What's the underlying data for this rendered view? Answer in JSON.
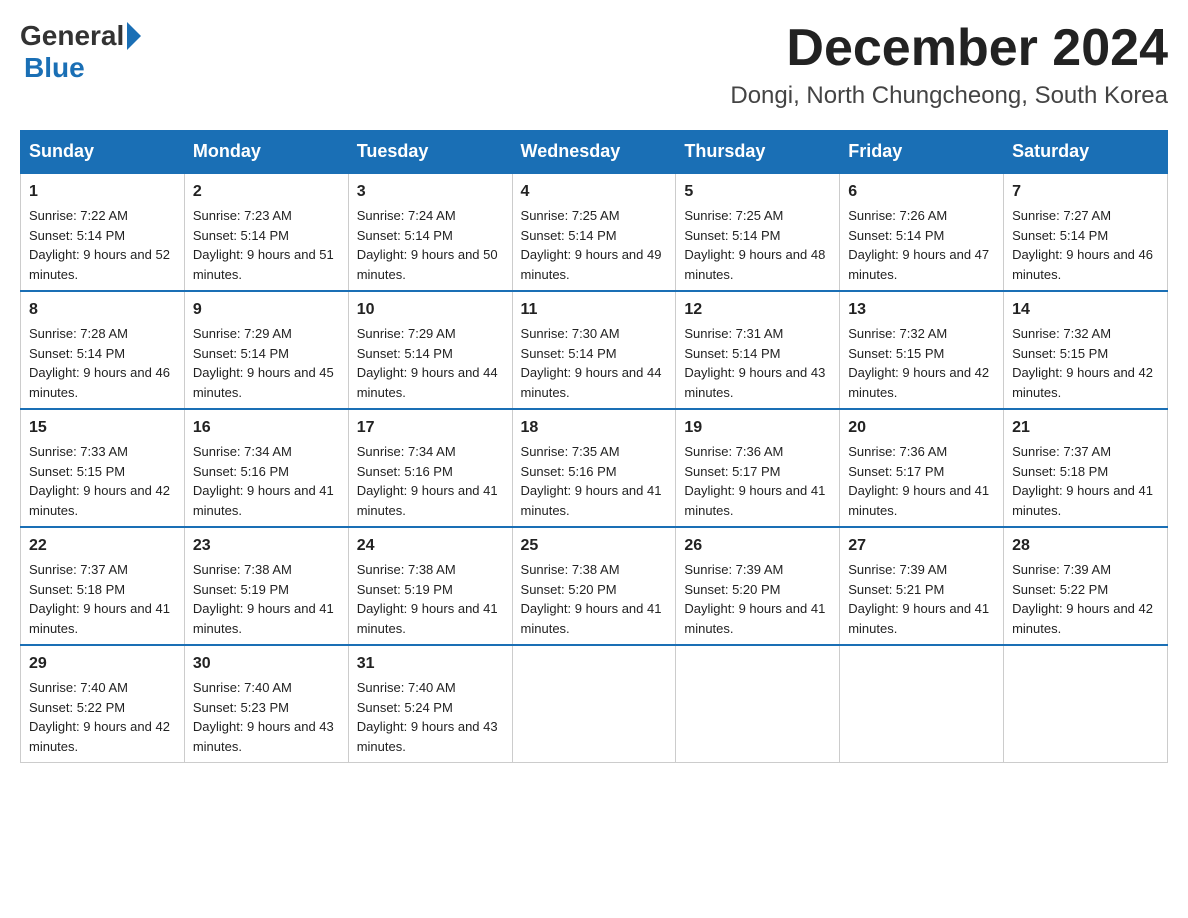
{
  "logo": {
    "general": "General",
    "blue": "Blue"
  },
  "header": {
    "month": "December 2024",
    "location": "Dongi, North Chungcheong, South Korea"
  },
  "weekdays": [
    "Sunday",
    "Monday",
    "Tuesday",
    "Wednesday",
    "Thursday",
    "Friday",
    "Saturday"
  ],
  "weeks": [
    [
      {
        "day": "1",
        "sunrise": "7:22 AM",
        "sunset": "5:14 PM",
        "daylight": "9 hours and 52 minutes."
      },
      {
        "day": "2",
        "sunrise": "7:23 AM",
        "sunset": "5:14 PM",
        "daylight": "9 hours and 51 minutes."
      },
      {
        "day": "3",
        "sunrise": "7:24 AM",
        "sunset": "5:14 PM",
        "daylight": "9 hours and 50 minutes."
      },
      {
        "day": "4",
        "sunrise": "7:25 AM",
        "sunset": "5:14 PM",
        "daylight": "9 hours and 49 minutes."
      },
      {
        "day": "5",
        "sunrise": "7:25 AM",
        "sunset": "5:14 PM",
        "daylight": "9 hours and 48 minutes."
      },
      {
        "day": "6",
        "sunrise": "7:26 AM",
        "sunset": "5:14 PM",
        "daylight": "9 hours and 47 minutes."
      },
      {
        "day": "7",
        "sunrise": "7:27 AM",
        "sunset": "5:14 PM",
        "daylight": "9 hours and 46 minutes."
      }
    ],
    [
      {
        "day": "8",
        "sunrise": "7:28 AM",
        "sunset": "5:14 PM",
        "daylight": "9 hours and 46 minutes."
      },
      {
        "day": "9",
        "sunrise": "7:29 AM",
        "sunset": "5:14 PM",
        "daylight": "9 hours and 45 minutes."
      },
      {
        "day": "10",
        "sunrise": "7:29 AM",
        "sunset": "5:14 PM",
        "daylight": "9 hours and 44 minutes."
      },
      {
        "day": "11",
        "sunrise": "7:30 AM",
        "sunset": "5:14 PM",
        "daylight": "9 hours and 44 minutes."
      },
      {
        "day": "12",
        "sunrise": "7:31 AM",
        "sunset": "5:14 PM",
        "daylight": "9 hours and 43 minutes."
      },
      {
        "day": "13",
        "sunrise": "7:32 AM",
        "sunset": "5:15 PM",
        "daylight": "9 hours and 42 minutes."
      },
      {
        "day": "14",
        "sunrise": "7:32 AM",
        "sunset": "5:15 PM",
        "daylight": "9 hours and 42 minutes."
      }
    ],
    [
      {
        "day": "15",
        "sunrise": "7:33 AM",
        "sunset": "5:15 PM",
        "daylight": "9 hours and 42 minutes."
      },
      {
        "day": "16",
        "sunrise": "7:34 AM",
        "sunset": "5:16 PM",
        "daylight": "9 hours and 41 minutes."
      },
      {
        "day": "17",
        "sunrise": "7:34 AM",
        "sunset": "5:16 PM",
        "daylight": "9 hours and 41 minutes."
      },
      {
        "day": "18",
        "sunrise": "7:35 AM",
        "sunset": "5:16 PM",
        "daylight": "9 hours and 41 minutes."
      },
      {
        "day": "19",
        "sunrise": "7:36 AM",
        "sunset": "5:17 PM",
        "daylight": "9 hours and 41 minutes."
      },
      {
        "day": "20",
        "sunrise": "7:36 AM",
        "sunset": "5:17 PM",
        "daylight": "9 hours and 41 minutes."
      },
      {
        "day": "21",
        "sunrise": "7:37 AM",
        "sunset": "5:18 PM",
        "daylight": "9 hours and 41 minutes."
      }
    ],
    [
      {
        "day": "22",
        "sunrise": "7:37 AM",
        "sunset": "5:18 PM",
        "daylight": "9 hours and 41 minutes."
      },
      {
        "day": "23",
        "sunrise": "7:38 AM",
        "sunset": "5:19 PM",
        "daylight": "9 hours and 41 minutes."
      },
      {
        "day": "24",
        "sunrise": "7:38 AM",
        "sunset": "5:19 PM",
        "daylight": "9 hours and 41 minutes."
      },
      {
        "day": "25",
        "sunrise": "7:38 AM",
        "sunset": "5:20 PM",
        "daylight": "9 hours and 41 minutes."
      },
      {
        "day": "26",
        "sunrise": "7:39 AM",
        "sunset": "5:20 PM",
        "daylight": "9 hours and 41 minutes."
      },
      {
        "day": "27",
        "sunrise": "7:39 AM",
        "sunset": "5:21 PM",
        "daylight": "9 hours and 41 minutes."
      },
      {
        "day": "28",
        "sunrise": "7:39 AM",
        "sunset": "5:22 PM",
        "daylight": "9 hours and 42 minutes."
      }
    ],
    [
      {
        "day": "29",
        "sunrise": "7:40 AM",
        "sunset": "5:22 PM",
        "daylight": "9 hours and 42 minutes."
      },
      {
        "day": "30",
        "sunrise": "7:40 AM",
        "sunset": "5:23 PM",
        "daylight": "9 hours and 43 minutes."
      },
      {
        "day": "31",
        "sunrise": "7:40 AM",
        "sunset": "5:24 PM",
        "daylight": "9 hours and 43 minutes."
      },
      null,
      null,
      null,
      null
    ]
  ]
}
